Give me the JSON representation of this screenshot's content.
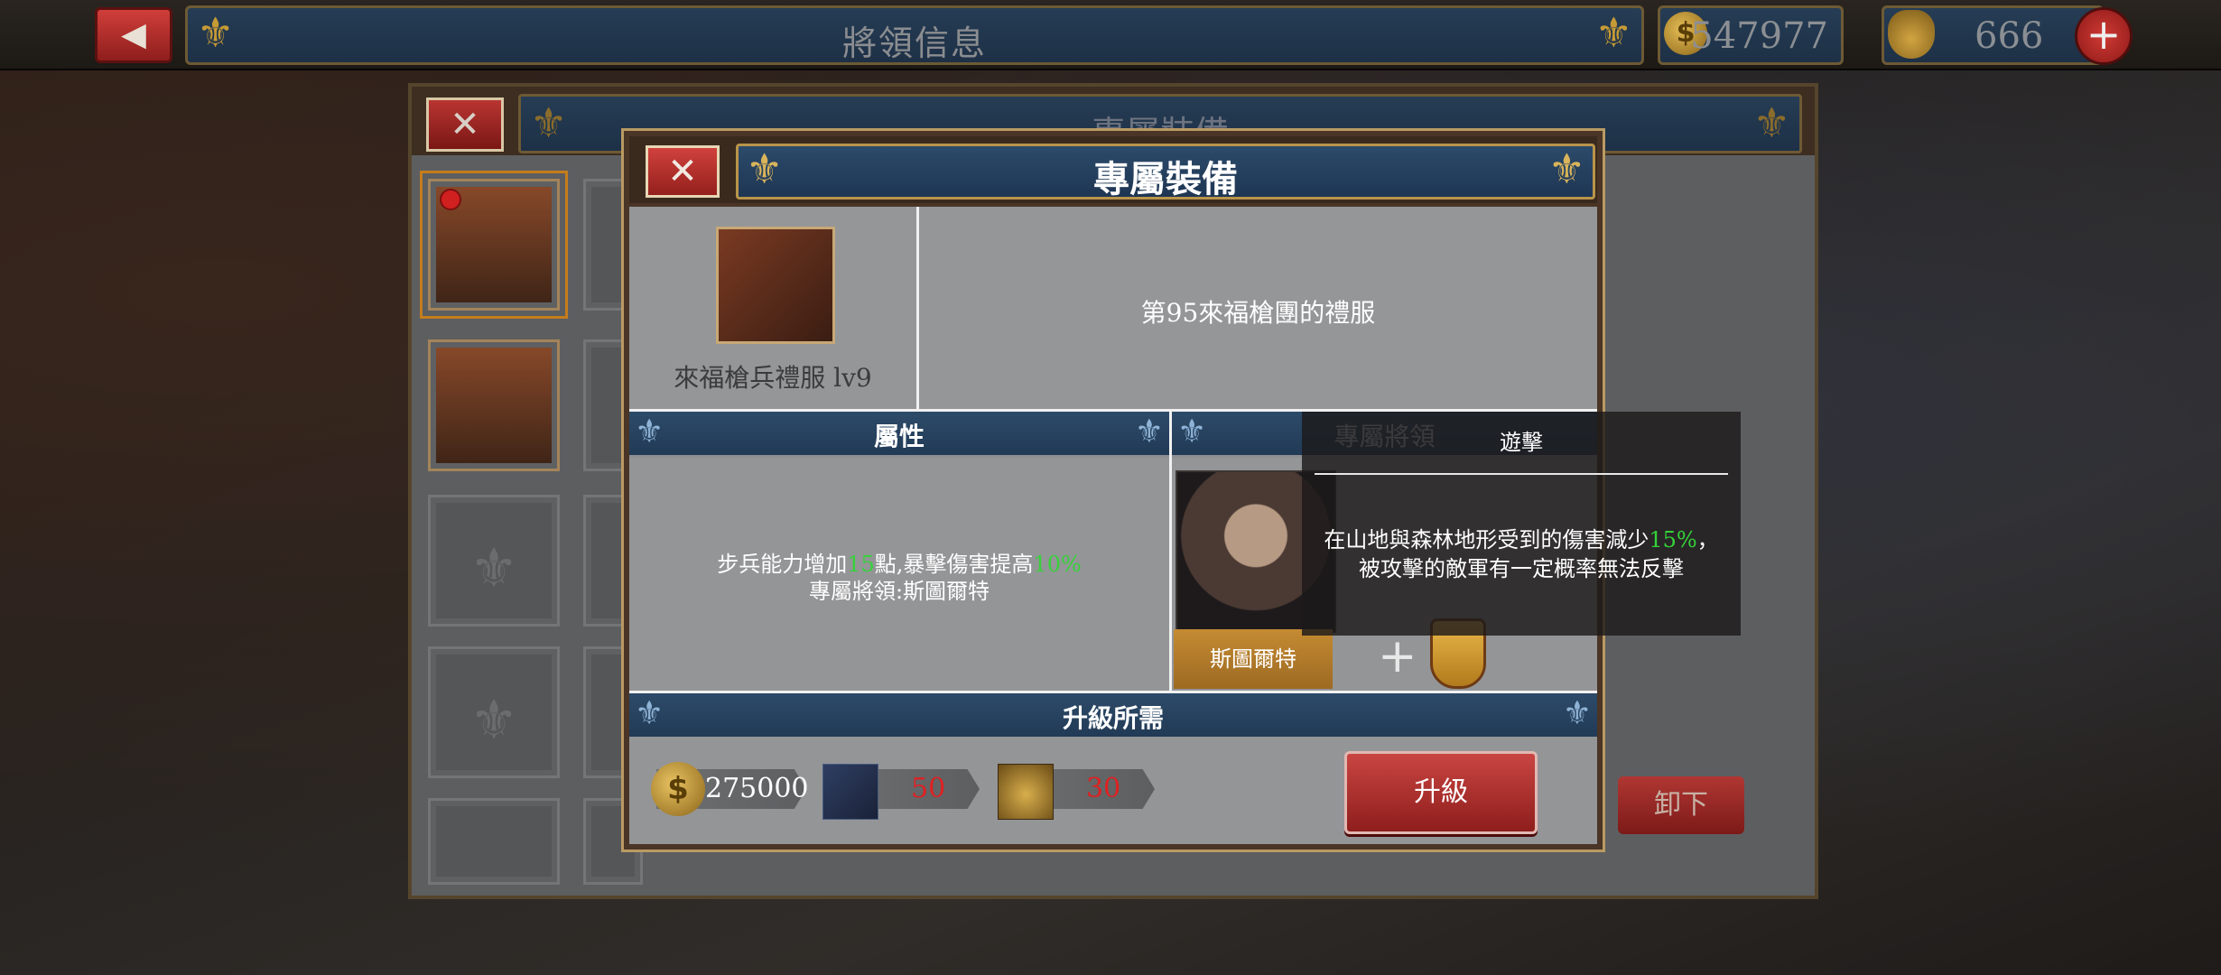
{
  "topbar": {
    "back_label": "◀",
    "title": "將領信息",
    "coins": "547977",
    "medals": "666",
    "add_label": "+"
  },
  "back_panel": {
    "title": "專屬裝備",
    "close_label": "✕",
    "uninstall_label": "卸下"
  },
  "modal": {
    "title": "專屬裝備",
    "close_label": "✕",
    "item_name": "來福槍兵禮服 lv9",
    "item_desc": "第95來福槍團的禮服",
    "attr_header": "屬性",
    "attr_line1_prefix": "步兵能力增加",
    "attr_line1_num": "15",
    "attr_line1_mid": "點,暴擊傷害提高",
    "attr_line1_pct": "10%",
    "attr_line2": "專屬將領:斯圖爾特",
    "general_header": "專屬將領",
    "general_name": "斯圖爾特",
    "add_symbol": "+",
    "req_header": "升級所需",
    "cost_coin": "275000",
    "cost_ingot": "50",
    "cost_medal": "30",
    "upgrade_label": "升級"
  },
  "tooltip": {
    "title": "遊擊",
    "desc_prefix": "在山地與森林地形受到的傷害減少",
    "desc_pct": "15%",
    "desc_suffix": "，被攻擊的敵軍有一定概率無法反擊"
  },
  "colors": {
    "accent_gold": "#c69a35",
    "header_blue": "#2d4b69",
    "button_red": "#c94542",
    "highlight_green": "#35d23a",
    "cost_red": "#e02020"
  }
}
